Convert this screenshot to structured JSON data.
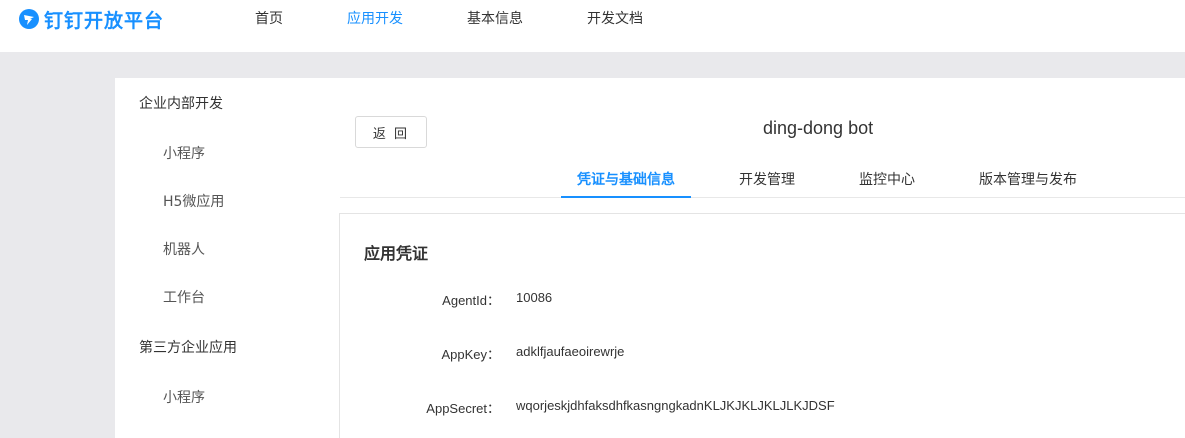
{
  "header": {
    "brand": "钉钉开放平台",
    "nav": [
      {
        "label": "首页",
        "active": false
      },
      {
        "label": "应用开发",
        "active": true
      },
      {
        "label": "基本信息",
        "active": false
      },
      {
        "label": "开发文档",
        "active": false
      }
    ]
  },
  "sidebar": {
    "groups": [
      {
        "label": "企业内部开发",
        "items": [
          "小程序",
          "H5微应用",
          "机器人",
          "工作台"
        ]
      },
      {
        "label": "第三方企业应用",
        "items": [
          "小程序"
        ]
      }
    ]
  },
  "main": {
    "back_label": "返 回",
    "app_title": "ding-dong bot",
    "tabs": [
      "凭证与基础信息",
      "开发管理",
      "监控中心",
      "版本管理与发布"
    ],
    "active_tab": 0,
    "section_title": "应用凭证",
    "fields": [
      {
        "label": "AgentId：",
        "value": "10086"
      },
      {
        "label": "AppKey：",
        "value": "adklfjaufaeoirewrje"
      },
      {
        "label": "AppSecret：",
        "value": "wqorjeskjdhfaksdhfkasngngkadnKLJKJKLJKLJLKJDSF"
      }
    ]
  },
  "colors": {
    "accent": "#1890ff",
    "background": "#e9e9ec"
  },
  "icons": {
    "brand": "dingtalk-logo-icon"
  }
}
